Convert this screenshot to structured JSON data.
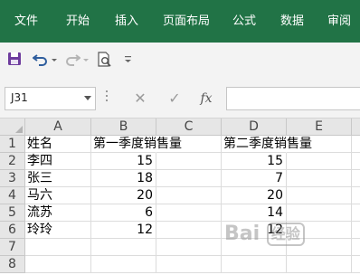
{
  "ribbon": {
    "tabs": [
      "文件",
      "开始",
      "插入",
      "页面布局",
      "公式",
      "数据",
      "审阅"
    ],
    "color": "#217346"
  },
  "toolbar": {
    "icons": [
      "save-icon",
      "undo-icon",
      "redo-icon",
      "print-preview-icon",
      "customize-toolbar-icon"
    ]
  },
  "formula_bar": {
    "name_box": "J31",
    "cancel_symbol": "✕",
    "enter_symbol": "✓",
    "function_label": "fx",
    "formula": ""
  },
  "sheet": {
    "columns": [
      "A",
      "B",
      "C",
      "D",
      "E"
    ],
    "rows": [
      "1",
      "2",
      "3",
      "4",
      "5",
      "6",
      "7",
      "8"
    ],
    "cells": {
      "A1": "姓名",
      "B1": "第一季度销售量",
      "D1": "第二季度销售量",
      "A2": "李四",
      "B2": "15",
      "D2": "15",
      "A3": "张三",
      "B3": "18",
      "D3": "7",
      "A4": "马六",
      "B4": "20",
      "D4": "20",
      "A5": "流苏",
      "B5": "6",
      "D5": "14",
      "A6": "玲玲",
      "B6": "12",
      "D6": "12"
    }
  },
  "watermark": {
    "text": "Bai",
    "box_text": "经验"
  }
}
